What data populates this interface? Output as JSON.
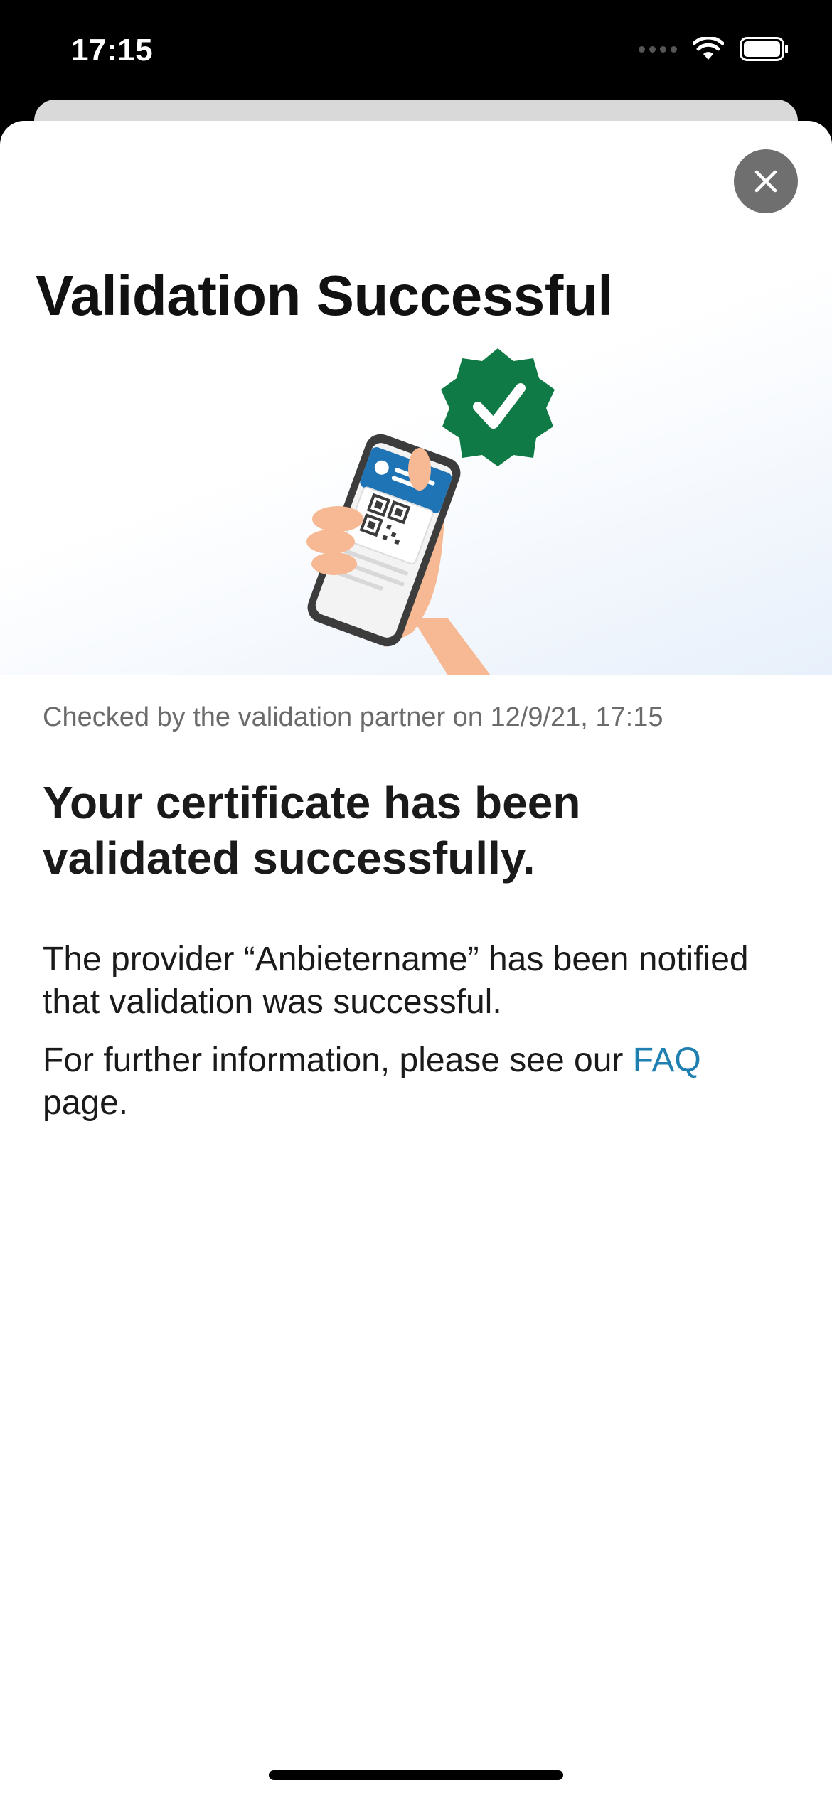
{
  "status_bar": {
    "time": "17:15",
    "icons": [
      "signal-dots-icon",
      "wifi-icon",
      "battery-icon"
    ]
  },
  "sheet": {
    "close_icon": "close-icon",
    "title": "Validation Successful",
    "illustration_icons": [
      "hand-holding-phone-icon",
      "qr-code-icon",
      "verified-badge-icon"
    ],
    "checked_info": "Checked by the validation partner on 12/9/21, 17:15",
    "headline": "Your certificate has been validated successfully.",
    "paragraph1": "The provider “Anbietername” has been notified that validation was successful.",
    "paragraph2_prefix": "For further information, please see our ",
    "faq_link": "FAQ",
    "paragraph2_suffix": " page."
  },
  "colors": {
    "accent_link": "#1e7fb0",
    "badge_green": "#0f7a45",
    "close_button_bg": "#6f6f6f",
    "card_blue": "#1f74b6",
    "skin": "#f6b993"
  }
}
